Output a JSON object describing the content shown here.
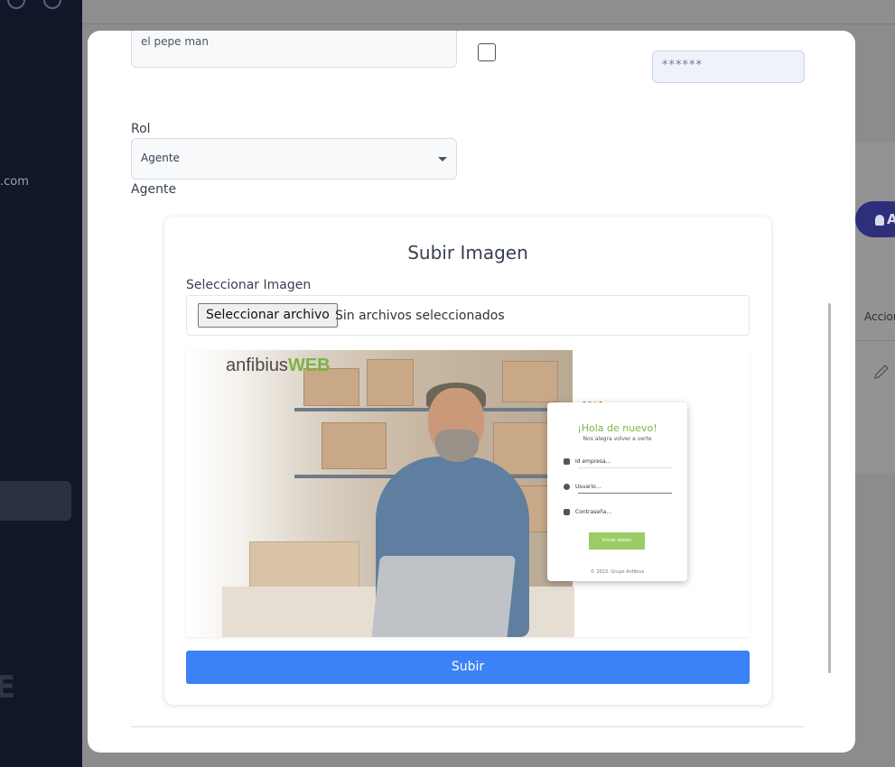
{
  "background": {
    "sidebar": {
      "email_fragment": ".com",
      "logo_fragment": "E"
    },
    "table": {
      "column_header_fragment": "Accion",
      "add_button_fragment": "A"
    }
  },
  "form": {
    "name_field_value": "el pepe man",
    "password_value": "******",
    "role": {
      "label": "Rol",
      "selected": "Agente",
      "current_value": "Agente"
    }
  },
  "upload_card": {
    "title": "Subir Imagen",
    "select_label": "Seleccionar Imagen",
    "file_button_label": "Seleccionar archivo",
    "file_status": "Sin archivos seleccionados",
    "preview": {
      "logo_text_1": "anfibius",
      "logo_text_2": "WEB",
      "login_title": "¡Hola de nuevo!",
      "login_subtitle": "Nos alegra volver a verte",
      "field_company": "Id empresa...",
      "field_user": "Usuario...",
      "field_password": "Contraseña...",
      "login_button": "Iniciar sesión",
      "footer": "© 2023. Grupo Anfibius"
    },
    "submit_label": "Subir"
  },
  "colors": {
    "primary_button": "#3b82f6",
    "brand_green": "#7cb342",
    "sidebar_bg": "#0f1728"
  }
}
